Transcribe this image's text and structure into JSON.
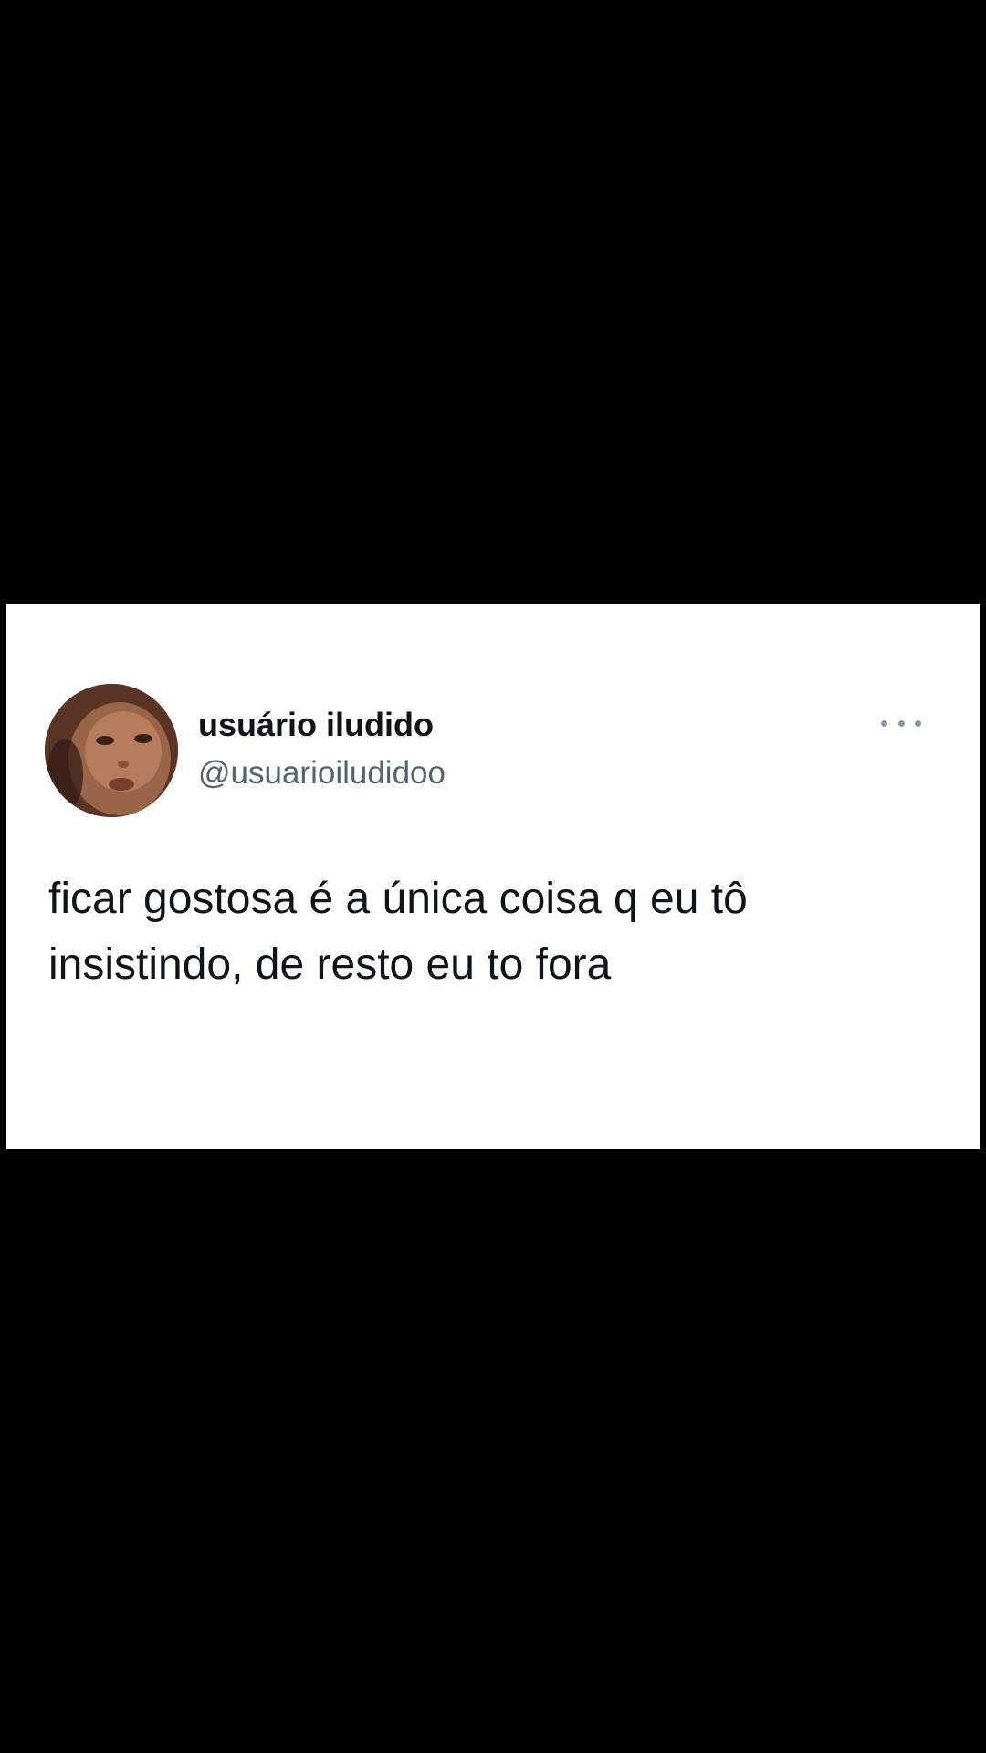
{
  "tweet": {
    "display_name": "usuário iludido",
    "handle": "@usuarioiludidoo",
    "text": "ficar gostosa é a única coisa q eu tô\ninsistindo, de resto eu to fora",
    "more_icon": "more-horizontal-icon"
  },
  "colors": {
    "background": "#000000",
    "card": "#ffffff",
    "text_primary": "#0f1419",
    "text_secondary": "#536471"
  }
}
